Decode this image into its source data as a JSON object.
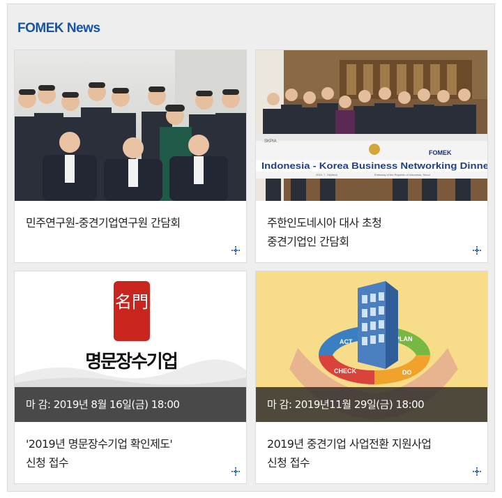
{
  "section": {
    "title": "FOMEK News"
  },
  "cards": [
    {
      "caption_lines": [
        "민주연구원-중견기업연구원 간담회"
      ],
      "deadline": ""
    },
    {
      "caption_lines": [
        "주한인도네시아 대사 초청",
        "중견기업인 간담회"
      ],
      "deadline": "",
      "banner_text": "Indonesia - Korea Business Networking Dinne",
      "banner_logo_left": "SKPIA",
      "banner_logo_right": "FOMEK",
      "banner_sub_left": "2019. 7. 24(Wed)",
      "banner_sub_right": "Embassy of the Republic of Indonesia, Seoul"
    },
    {
      "caption_lines": [
        "'2019년 명문장수기업 확인제도'",
        "신청 접수"
      ],
      "deadline": "마 감: 2019년 8월 16일(금) 18:00",
      "logo_text": "명문장수기업",
      "seal_text": "名門"
    },
    {
      "caption_lines": [
        "2019년 중견기업 사업전환 지원사업",
        "신청 접수"
      ],
      "deadline": "마 감: 2019년11월 29일(금) 18:00",
      "cycle_labels": [
        "ACT",
        "PLAN",
        "DO",
        "CHECK"
      ]
    }
  ],
  "colors": {
    "title": "#1554a8",
    "more_icon": "#3a73c6"
  },
  "icons": {
    "more": "plus-more-icon"
  }
}
